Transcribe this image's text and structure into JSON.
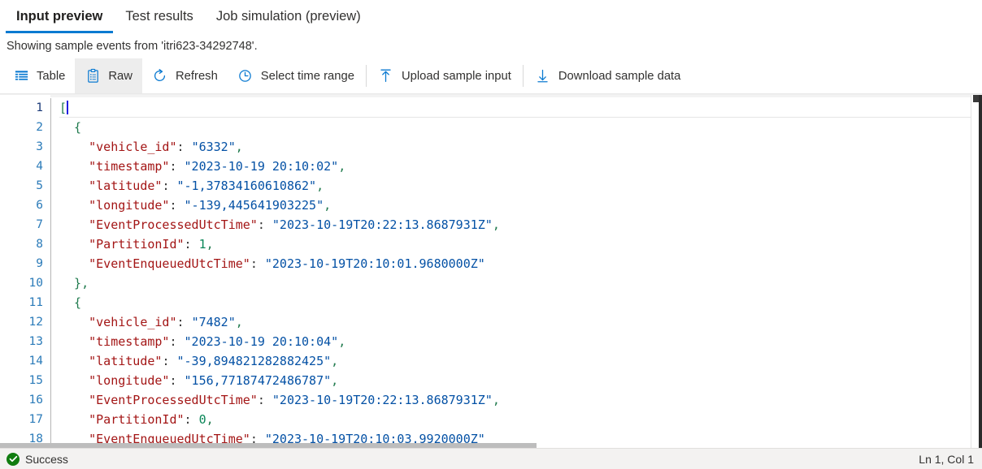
{
  "tabs": [
    {
      "label": "Input preview",
      "active": true
    },
    {
      "label": "Test results",
      "active": false
    },
    {
      "label": "Job simulation (preview)",
      "active": false
    }
  ],
  "subtitle": "Showing sample events from 'itri623-34292748'.",
  "commands": [
    {
      "label": "Table",
      "icon": "table-icon",
      "selected": false
    },
    {
      "label": "Raw",
      "icon": "clipboard-icon",
      "selected": true
    },
    {
      "label": "Refresh",
      "icon": "refresh-icon",
      "selected": false
    },
    {
      "label": "Select time range",
      "icon": "clock-icon",
      "selected": false
    },
    {
      "label": "Upload sample input",
      "icon": "upload-icon",
      "selected": false
    },
    {
      "label": "Download sample data",
      "icon": "download-icon",
      "selected": false
    }
  ],
  "editor": {
    "lines": [
      {
        "n": "1",
        "tokens": [
          {
            "t": "[",
            "c": "brk"
          }
        ],
        "caret": true
      },
      {
        "n": "2",
        "tokens": [
          {
            "t": "  {",
            "c": "brk"
          }
        ]
      },
      {
        "n": "3",
        "tokens": [
          {
            "t": "    ",
            "c": "plain"
          },
          {
            "t": "\"vehicle_id\"",
            "c": "key"
          },
          {
            "t": ": ",
            "c": "plain"
          },
          {
            "t": "\"6332\"",
            "c": "str"
          },
          {
            "t": ",",
            "c": "punct"
          }
        ]
      },
      {
        "n": "4",
        "tokens": [
          {
            "t": "    ",
            "c": "plain"
          },
          {
            "t": "\"timestamp\"",
            "c": "key"
          },
          {
            "t": ": ",
            "c": "plain"
          },
          {
            "t": "\"2023-10-19 20:10:02\"",
            "c": "str"
          },
          {
            "t": ",",
            "c": "punct"
          }
        ]
      },
      {
        "n": "5",
        "tokens": [
          {
            "t": "    ",
            "c": "plain"
          },
          {
            "t": "\"latitude\"",
            "c": "key"
          },
          {
            "t": ": ",
            "c": "plain"
          },
          {
            "t": "\"-1,37834160610862\"",
            "c": "str"
          },
          {
            "t": ",",
            "c": "punct"
          }
        ]
      },
      {
        "n": "6",
        "tokens": [
          {
            "t": "    ",
            "c": "plain"
          },
          {
            "t": "\"longitude\"",
            "c": "key"
          },
          {
            "t": ": ",
            "c": "plain"
          },
          {
            "t": "\"-139,445641903225\"",
            "c": "str"
          },
          {
            "t": ",",
            "c": "punct"
          }
        ]
      },
      {
        "n": "7",
        "tokens": [
          {
            "t": "    ",
            "c": "plain"
          },
          {
            "t": "\"EventProcessedUtcTime\"",
            "c": "key"
          },
          {
            "t": ": ",
            "c": "plain"
          },
          {
            "t": "\"2023-10-19T20:22:13.8687931Z\"",
            "c": "str"
          },
          {
            "t": ",",
            "c": "punct"
          }
        ]
      },
      {
        "n": "8",
        "tokens": [
          {
            "t": "    ",
            "c": "plain"
          },
          {
            "t": "\"PartitionId\"",
            "c": "key"
          },
          {
            "t": ": ",
            "c": "plain"
          },
          {
            "t": "1",
            "c": "num"
          },
          {
            "t": ",",
            "c": "punct"
          }
        ]
      },
      {
        "n": "9",
        "tokens": [
          {
            "t": "    ",
            "c": "plain"
          },
          {
            "t": "\"EventEnqueuedUtcTime\"",
            "c": "key"
          },
          {
            "t": ": ",
            "c": "plain"
          },
          {
            "t": "\"2023-10-19T20:10:01.9680000Z\"",
            "c": "str"
          }
        ]
      },
      {
        "n": "10",
        "tokens": [
          {
            "t": "  }",
            "c": "brk"
          },
          {
            "t": ",",
            "c": "punct"
          }
        ]
      },
      {
        "n": "11",
        "tokens": [
          {
            "t": "  {",
            "c": "brk"
          }
        ]
      },
      {
        "n": "12",
        "tokens": [
          {
            "t": "    ",
            "c": "plain"
          },
          {
            "t": "\"vehicle_id\"",
            "c": "key"
          },
          {
            "t": ": ",
            "c": "plain"
          },
          {
            "t": "\"7482\"",
            "c": "str"
          },
          {
            "t": ",",
            "c": "punct"
          }
        ]
      },
      {
        "n": "13",
        "tokens": [
          {
            "t": "    ",
            "c": "plain"
          },
          {
            "t": "\"timestamp\"",
            "c": "key"
          },
          {
            "t": ": ",
            "c": "plain"
          },
          {
            "t": "\"2023-10-19 20:10:04\"",
            "c": "str"
          },
          {
            "t": ",",
            "c": "punct"
          }
        ]
      },
      {
        "n": "14",
        "tokens": [
          {
            "t": "    ",
            "c": "plain"
          },
          {
            "t": "\"latitude\"",
            "c": "key"
          },
          {
            "t": ": ",
            "c": "plain"
          },
          {
            "t": "\"-39,894821282882425\"",
            "c": "str"
          },
          {
            "t": ",",
            "c": "punct"
          }
        ]
      },
      {
        "n": "15",
        "tokens": [
          {
            "t": "    ",
            "c": "plain"
          },
          {
            "t": "\"longitude\"",
            "c": "key"
          },
          {
            "t": ": ",
            "c": "plain"
          },
          {
            "t": "\"156,77187472486787\"",
            "c": "str"
          },
          {
            "t": ",",
            "c": "punct"
          }
        ]
      },
      {
        "n": "16",
        "tokens": [
          {
            "t": "    ",
            "c": "plain"
          },
          {
            "t": "\"EventProcessedUtcTime\"",
            "c": "key"
          },
          {
            "t": ": ",
            "c": "plain"
          },
          {
            "t": "\"2023-10-19T20:22:13.8687931Z\"",
            "c": "str"
          },
          {
            "t": ",",
            "c": "punct"
          }
        ]
      },
      {
        "n": "17",
        "tokens": [
          {
            "t": "    ",
            "c": "plain"
          },
          {
            "t": "\"PartitionId\"",
            "c": "key"
          },
          {
            "t": ": ",
            "c": "plain"
          },
          {
            "t": "0",
            "c": "num"
          },
          {
            "t": ",",
            "c": "punct"
          }
        ]
      },
      {
        "n": "18",
        "tokens": [
          {
            "t": "    ",
            "c": "plain"
          },
          {
            "t": "\"EventEnqueuedUtcTime\"",
            "c": "key"
          },
          {
            "t": ": ",
            "c": "plain"
          },
          {
            "t": "\"2023-10-19T20:10:03.9920000Z\"",
            "c": "str"
          }
        ]
      }
    ]
  },
  "status": {
    "message": "Success",
    "icon": "success-check-icon",
    "position": "Ln 1, Col 1"
  },
  "colors": {
    "accent": "#0b7ad1",
    "success": "#107c10",
    "icon_blue": "#0b7ad1",
    "json_key": "#a31515",
    "json_string": "#0451a5",
    "json_number": "#098658",
    "json_bracket": "#1f7a4d",
    "line_number": "#2b7bb9"
  }
}
